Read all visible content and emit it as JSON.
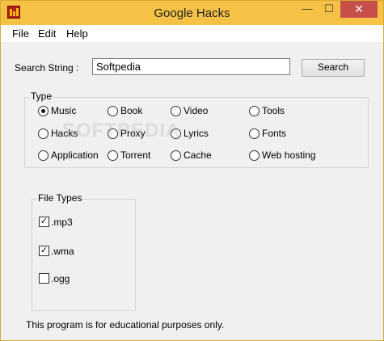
{
  "window": {
    "title": "Google Hacks",
    "close_glyph": "✕",
    "min_glyph": "—",
    "max_glyph": "☐"
  },
  "menu": {
    "items": [
      "File",
      "Edit",
      "Help"
    ]
  },
  "search": {
    "label": "Search String :",
    "value": "Softpedia",
    "button": "Search"
  },
  "type_group": {
    "title": "Type",
    "options": [
      {
        "label": "Music",
        "selected": true
      },
      {
        "label": "Book",
        "selected": false
      },
      {
        "label": "Video",
        "selected": false
      },
      {
        "label": "Tools",
        "selected": false
      },
      {
        "label": "Hacks",
        "selected": false
      },
      {
        "label": "Proxy",
        "selected": false
      },
      {
        "label": "Lyrics",
        "selected": false
      },
      {
        "label": "Fonts",
        "selected": false
      },
      {
        "label": "Application",
        "selected": false
      },
      {
        "label": "Torrent",
        "selected": false
      },
      {
        "label": "Cache",
        "selected": false
      },
      {
        "label": "Web hosting",
        "selected": false
      }
    ]
  },
  "file_types": {
    "title": "File Types",
    "items": [
      {
        "label": ".mp3",
        "checked": true
      },
      {
        "label": ".wma",
        "checked": true
      },
      {
        "label": ".ogg",
        "checked": false
      }
    ]
  },
  "footer": {
    "note": "This program is for educational purposes only."
  },
  "watermark": "SOFTPEDIA",
  "colors": {
    "titlebar": "#f6c245",
    "close": "#c7504b"
  }
}
